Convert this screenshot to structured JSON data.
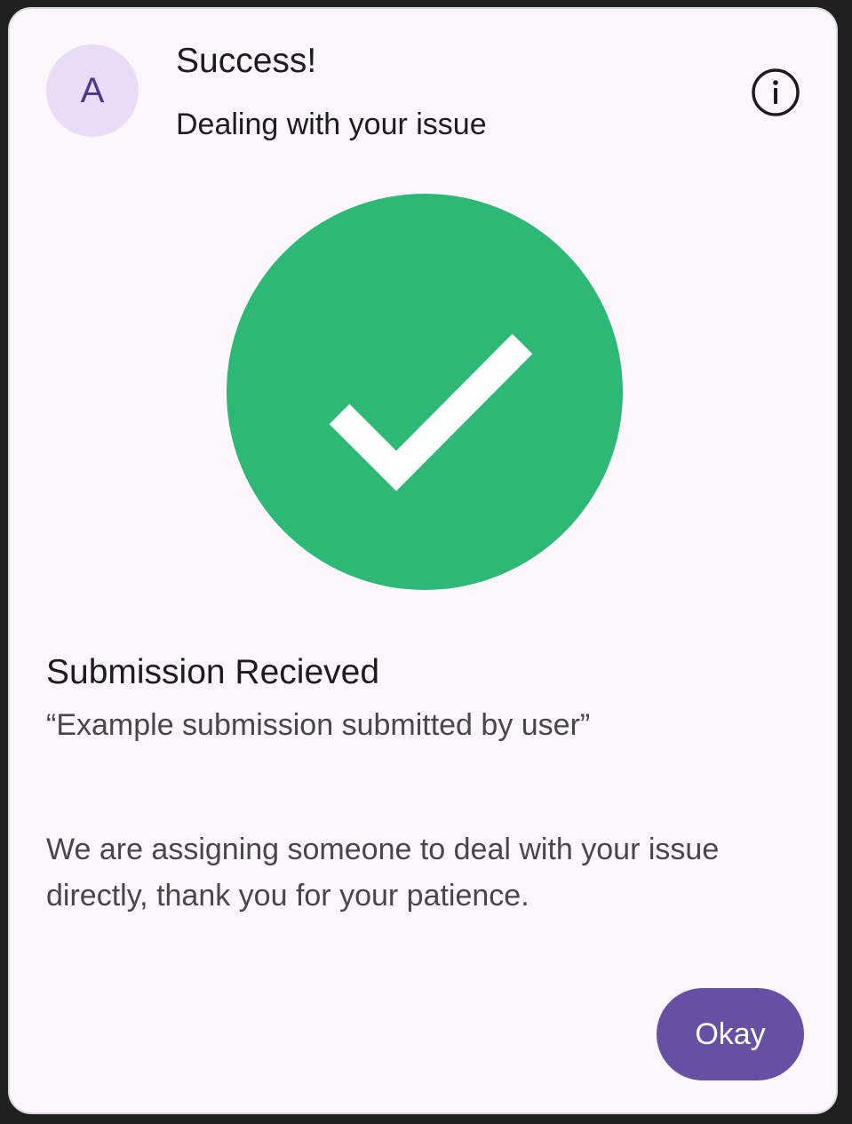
{
  "dialog": {
    "avatar_letter": "A",
    "title": "Success!",
    "subtitle": "Dealing with your issue",
    "info_icon": "info-icon",
    "status_icon": "check-circle-icon",
    "heading": "Submission Recieved",
    "quote": "“Example submission submitted by user”",
    "body": "We are assigning someone to deal with your issue directly, thank you for your patience.",
    "okay_label": "Okay"
  },
  "colors": {
    "surface": "#fdf6fc",
    "avatar_bg": "#eadcf7",
    "primary": "#6750a4",
    "success": "#2eb875"
  }
}
